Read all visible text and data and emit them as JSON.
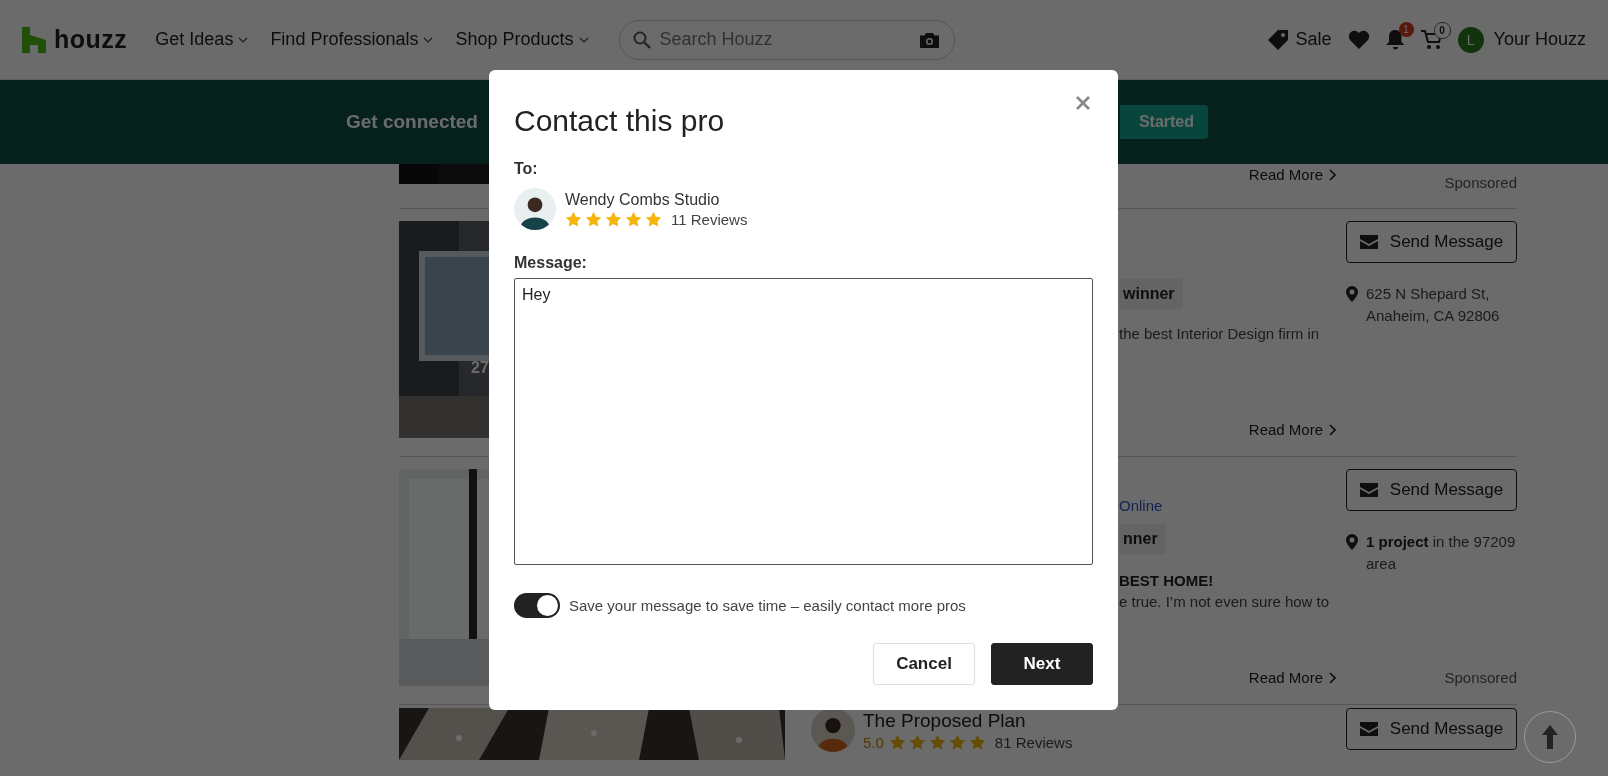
{
  "header": {
    "logo": "houzz",
    "nav": [
      {
        "label": "Get Ideas"
      },
      {
        "label": "Find Professionals"
      },
      {
        "label": "Shop Products"
      }
    ],
    "search": {
      "placeholder": "Search Houzz"
    },
    "sale": "Sale",
    "notifications": "1",
    "cart": "0",
    "user_initial": "L",
    "user": "Your Houzz"
  },
  "banner": {
    "text": "Get connected",
    "button": "Started"
  },
  "listings": [
    {
      "kind": "tail",
      "read_more": "Read More",
      "sponsored": "Sponsored"
    },
    {
      "kind": "covered",
      "photo_count": "27",
      "badge": "winner",
      "description": "the best Interior Design firm in",
      "read_more": "Read More",
      "button": "Send Message",
      "location": "625 N Shepard St, Anaheim, CA 92806"
    },
    {
      "kind": "covered",
      "status": "Online",
      "badge": "nner",
      "headline": "BEST HOME!",
      "description": "e true. I’m not even sure how to",
      "read_more": "Read More",
      "sponsored": "Sponsored",
      "button": "Send Message",
      "location": "**1 project** in the 97209 area"
    },
    {
      "kind": "open",
      "name": "The Proposed Plan",
      "rating": "5.0",
      "stars": 5,
      "reviews": "81 Reviews",
      "button": "Send Message"
    }
  ],
  "modal": {
    "title": "Contact this pro",
    "to_label": "To:",
    "recipient": {
      "name": "Wendy Combs Studio",
      "stars": 5,
      "reviews": "11 Reviews"
    },
    "message_label": "Message:",
    "message": "Hey",
    "save_toggle": {
      "label": "Save your message to save time – easily contact more pros",
      "on": true
    },
    "buttons": [
      {
        "label": "Cancel",
        "kind": "secondary"
      },
      {
        "label": "Next",
        "kind": "primary"
      }
    ]
  }
}
